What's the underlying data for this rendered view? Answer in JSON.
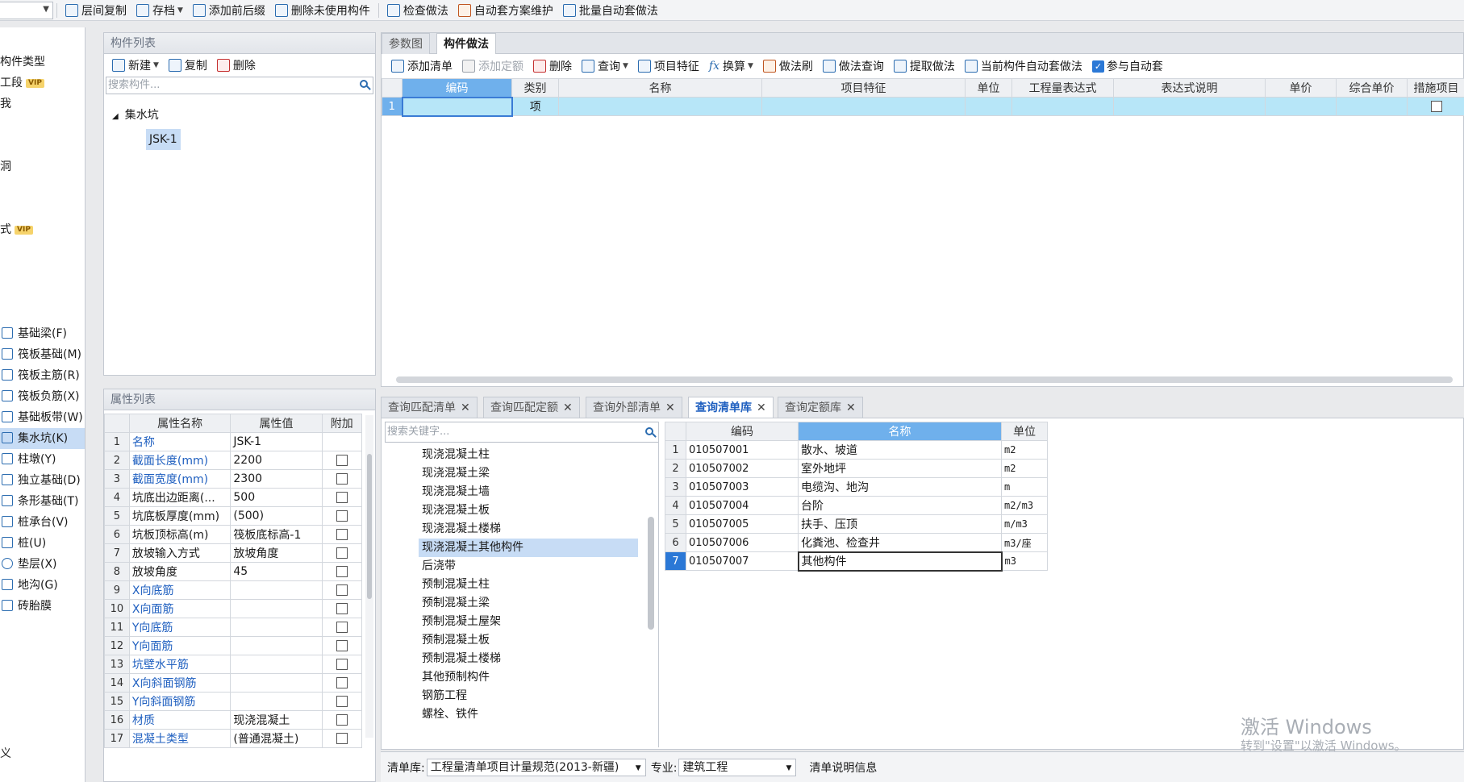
{
  "toolbar": {
    "items": [
      {
        "label": "层间复制",
        "icon": "copy-floors-icon"
      },
      {
        "label": "存档",
        "icon": "archive-icon",
        "dropdown": true
      },
      {
        "label": "添加前后缀",
        "icon": "prefix-suffix-icon"
      },
      {
        "label": "删除未使用构件",
        "icon": "delete-unused-icon"
      },
      {
        "label": "检查做法",
        "icon": "check-method-icon"
      },
      {
        "label": "自动套方案维护",
        "icon": "auto-scheme-icon"
      },
      {
        "label": "批量自动套做法",
        "icon": "batch-auto-icon"
      }
    ]
  },
  "left_categories": [
    {
      "label": "构件类型"
    },
    {
      "label": "工段",
      "vip": "VIP"
    },
    {
      "label": "我"
    },
    {
      "label": "洞"
    },
    {
      "label": "式",
      "vip": "VIP"
    },
    {
      "label": "基础梁(F)"
    },
    {
      "label": "筏板基础(M)"
    },
    {
      "label": "筏板主筋(R)"
    },
    {
      "label": "筏板负筋(X)"
    },
    {
      "label": "基础板带(W)"
    },
    {
      "label": "集水坑(K)",
      "selected": true
    },
    {
      "label": "柱墩(Y)"
    },
    {
      "label": "独立基础(D)"
    },
    {
      "label": "条形基础(T)"
    },
    {
      "label": "桩承台(V)"
    },
    {
      "label": "桩(U)"
    },
    {
      "label": "垫层(X)"
    },
    {
      "label": "地沟(G)"
    },
    {
      "label": "砖胎膜"
    },
    {
      "label": "义"
    }
  ],
  "component_list": {
    "title": "构件列表",
    "new_label": "新建",
    "copy_label": "复制",
    "delete_label": "删除",
    "search_placeholder": "搜索构件...",
    "tree_root": "集水坑",
    "tree_child": "JSK-1"
  },
  "property_list": {
    "title": "属性列表",
    "headers": [
      "属性名称",
      "属性值",
      "附加"
    ],
    "rows": [
      {
        "n": "1",
        "name": "名称",
        "value": "JSK-1",
        "blue": true,
        "check": false
      },
      {
        "n": "2",
        "name": "截面长度(mm)",
        "value": "2200",
        "blue": true,
        "check": true
      },
      {
        "n": "3",
        "name": "截面宽度(mm)",
        "value": "2300",
        "blue": true,
        "check": true
      },
      {
        "n": "4",
        "name": "坑底出边距离(...",
        "value": "500",
        "blue": false,
        "check": true
      },
      {
        "n": "5",
        "name": "坑底板厚度(mm)",
        "value": "(500)",
        "blue": false,
        "check": true
      },
      {
        "n": "6",
        "name": "坑板顶标高(m)",
        "value": "筏板底标高-1",
        "blue": false,
        "check": true
      },
      {
        "n": "7",
        "name": "放坡输入方式",
        "value": "放坡角度",
        "blue": false,
        "check": true
      },
      {
        "n": "8",
        "name": "放坡角度",
        "value": "45",
        "blue": false,
        "check": true
      },
      {
        "n": "9",
        "name": "X向底筋",
        "value": "",
        "blue": true,
        "check": true
      },
      {
        "n": "10",
        "name": "X向面筋",
        "value": "",
        "blue": true,
        "check": true
      },
      {
        "n": "11",
        "name": "Y向底筋",
        "value": "",
        "blue": true,
        "check": true
      },
      {
        "n": "12",
        "name": "Y向面筋",
        "value": "",
        "blue": true,
        "check": true
      },
      {
        "n": "13",
        "name": "坑壁水平筋",
        "value": "",
        "blue": true,
        "check": true
      },
      {
        "n": "14",
        "name": "X向斜面钢筋",
        "value": "",
        "blue": true,
        "check": true
      },
      {
        "n": "15",
        "name": "Y向斜面钢筋",
        "value": "",
        "blue": true,
        "check": true
      },
      {
        "n": "16",
        "name": "材质",
        "value": "现浇混凝土",
        "blue": true,
        "check": true
      },
      {
        "n": "17",
        "name": "混凝土类型",
        "value": "(普通混凝土)",
        "blue": true,
        "check": true
      }
    ]
  },
  "method_tabs": [
    "参数图",
    "构件做法"
  ],
  "method_toolbar": [
    {
      "label": "添加清单",
      "icon": "add-list-icon"
    },
    {
      "label": "添加定额",
      "icon": "add-quota-icon",
      "disabled": true
    },
    {
      "label": "删除",
      "icon": "delete-icon"
    },
    {
      "label": "查询",
      "icon": "query-icon",
      "dropdown": true
    },
    {
      "label": "项目特征",
      "icon": "project-feature-icon"
    },
    {
      "label": "换算",
      "icon": "fx-icon",
      "dropdown": true
    },
    {
      "label": "做法刷",
      "icon": "method-brush-icon"
    },
    {
      "label": "做法查询",
      "icon": "method-query-icon"
    },
    {
      "label": "提取做法",
      "icon": "extract-method-icon"
    },
    {
      "label": "当前构件自动套做法",
      "icon": "auto-apply-icon"
    },
    {
      "label": "参与自动套",
      "icon": "checkbox-checked-icon"
    }
  ],
  "method_grid": {
    "headers": [
      "编码",
      "类别",
      "名称",
      "项目特征",
      "单位",
      "工程量表达式",
      "表达式说明",
      "单价",
      "综合单价",
      "措施项目"
    ],
    "rows": [
      {
        "n": "1",
        "code": "",
        "type": "项",
        "name": "",
        "feature": "",
        "unit": "",
        "expr": "",
        "desc": "",
        "price": "",
        "total": ""
      }
    ]
  },
  "query_tabs": [
    {
      "label": "查询匹配清单"
    },
    {
      "label": "查询匹配定额"
    },
    {
      "label": "查询外部清单"
    },
    {
      "label": "查询清单库",
      "active": true
    },
    {
      "label": "查询定额库"
    }
  ],
  "query_search_placeholder": "搜索关键字...",
  "tree_items": [
    {
      "label": "现浇混凝土柱"
    },
    {
      "label": "现浇混凝土梁"
    },
    {
      "label": "现浇混凝土墙"
    },
    {
      "label": "现浇混凝土板"
    },
    {
      "label": "现浇混凝土楼梯"
    },
    {
      "label": "现浇混凝土其他构件",
      "selected": true
    },
    {
      "label": "后浇带"
    },
    {
      "label": "预制混凝土柱"
    },
    {
      "label": "预制混凝土梁"
    },
    {
      "label": "预制混凝土屋架"
    },
    {
      "label": "预制混凝土板"
    },
    {
      "label": "预制混凝土楼梯"
    },
    {
      "label": "其他预制构件"
    },
    {
      "label": "钢筋工程"
    },
    {
      "label": "螺栓、铁件"
    }
  ],
  "result_grid": {
    "headers": [
      "编码",
      "名称",
      "单位"
    ],
    "rows": [
      {
        "n": "1",
        "code": "010507001",
        "name": "散水、坡道",
        "unit": "m2"
      },
      {
        "n": "2",
        "code": "010507002",
        "name": "室外地坪",
        "unit": "m2"
      },
      {
        "n": "3",
        "code": "010507003",
        "name": "电缆沟、地沟",
        "unit": "m"
      },
      {
        "n": "4",
        "code": "010507004",
        "name": "台阶",
        "unit": "m2/m3"
      },
      {
        "n": "5",
        "code": "010507005",
        "name": "扶手、压顶",
        "unit": "m/m3"
      },
      {
        "n": "6",
        "code": "010507006",
        "name": "化粪池、检查井",
        "unit": "m3/座"
      },
      {
        "n": "7",
        "code": "010507007",
        "name": "其他构件",
        "unit": "m3",
        "selected": true
      }
    ]
  },
  "bottom_bar": {
    "library_label": "清单库:",
    "library_value": "工程量清单项目计量规范(2013-新疆)",
    "major_label": "专业:",
    "major_value": "建筑工程",
    "info_label": "清单说明信息"
  },
  "watermark": {
    "line1": "激活 Windows",
    "line2": "转到\"设置\"以激活 Windows。"
  },
  "colors": {
    "accent": "#2060c0",
    "selection": "#c7dcf5",
    "header_active": "#6fb0ec",
    "grid_row_active": "#b7e6f8"
  }
}
